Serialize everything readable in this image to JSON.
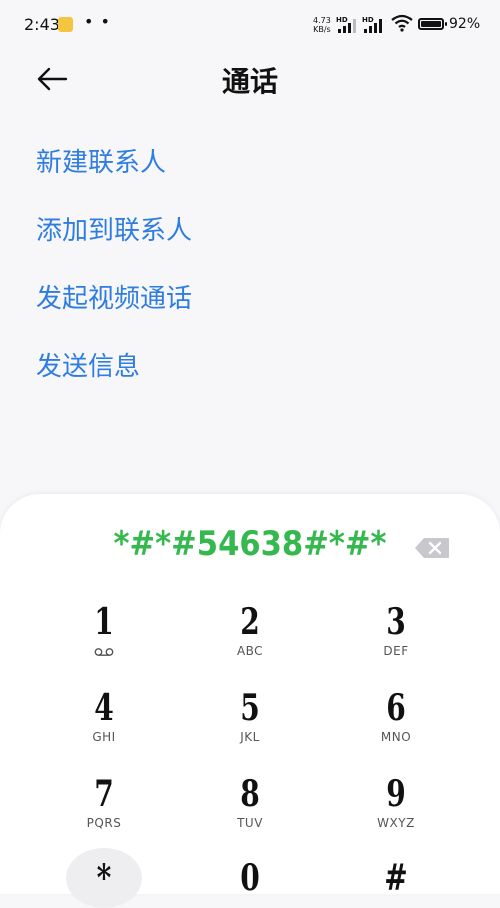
{
  "status_bar": {
    "time": "2:43",
    "dots": "• •",
    "speed_value": "4.73",
    "speed_unit": "KB/s",
    "hd1": "HD",
    "hd2": "HD",
    "battery": "92%"
  },
  "header": {
    "title": "通话"
  },
  "options": [
    "新建联系人",
    "添加到联系人",
    "发起视频通话",
    "发送信息"
  ],
  "dialer": {
    "number": "*#*#54638#*#*",
    "keys": [
      {
        "digit": "1",
        "letters": ""
      },
      {
        "digit": "2",
        "letters": "ABC"
      },
      {
        "digit": "3",
        "letters": "DEF"
      },
      {
        "digit": "4",
        "letters": "GHI"
      },
      {
        "digit": "5",
        "letters": "JKL"
      },
      {
        "digit": "6",
        "letters": "MNO"
      },
      {
        "digit": "7",
        "letters": "PQRS"
      },
      {
        "digit": "8",
        "letters": "TUV"
      },
      {
        "digit": "9",
        "letters": "WXYZ"
      },
      {
        "digit": "*",
        "letters": ""
      },
      {
        "digit": "0",
        "letters": ""
      },
      {
        "digit": "#",
        "letters": ""
      }
    ]
  },
  "colors": {
    "accent": "#2f7de1",
    "number": "#35b94f"
  },
  "icons": [
    "back-arrow-icon",
    "voicemail-icon",
    "backspace-icon",
    "wifi-icon",
    "signal-icon",
    "battery-icon"
  ]
}
